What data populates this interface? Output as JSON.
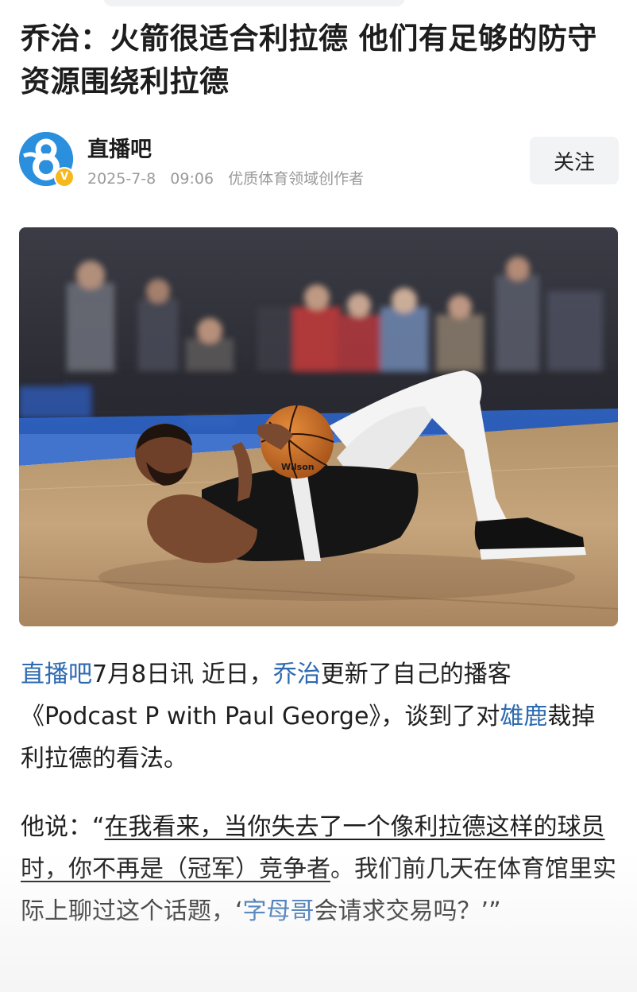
{
  "article": {
    "title": "乔治：火箭很适合利拉德 他们有足够的防守资源围绕利拉德"
  },
  "author": {
    "name": "直播吧",
    "avatar_glyph": "8",
    "badge": "V",
    "date": "2025-7-8",
    "time": "09:06",
    "role": "优质体育领域创作者",
    "follow_label": "关注"
  },
  "image": {
    "subject": "basketball-player-lying-on-court",
    "ball_brand": "Wilson"
  },
  "body": {
    "p1": {
      "source_link": "直播吧",
      "s1": "7月8日讯 近日，",
      "person_link": "乔治",
      "s2": "更新了自己的播客《Podcast P with Paul George》，谈到了对",
      "team_link": "雄鹿",
      "s3": "裁掉利拉德的看法。"
    },
    "p2": {
      "s1": "他说：“",
      "underlined": "在我看来，当你失去了一个像利拉德这样的球员时，你不再是（冠军）竞争者",
      "s2": "。我们前几天在体育馆里实际上聊过这个话题，‘",
      "person_link": "字母哥",
      "s3": "会请求交易吗？’”"
    }
  },
  "colors": {
    "link": "#2d6ab0",
    "avatar_bg": "#2a8fdd",
    "badge": "#f6b81c"
  }
}
